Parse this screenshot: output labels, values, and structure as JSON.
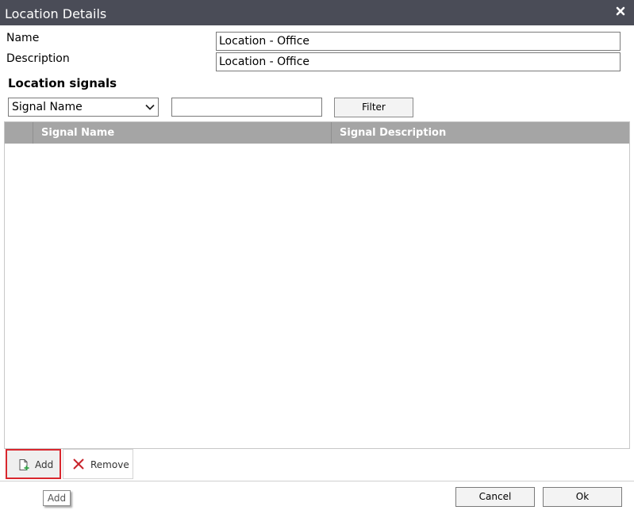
{
  "window": {
    "title": "Location Details",
    "close_icon": "close-icon"
  },
  "form": {
    "name_label": "Name",
    "name_value": "Location - Office",
    "description_label": "Description",
    "description_value": "Location - Office"
  },
  "signals": {
    "section_title": "Location signals",
    "filter_field_selected": "Signal Name",
    "filter_text_value": "",
    "filter_button_label": "Filter",
    "columns": [
      "Signal Name",
      "Signal Description"
    ],
    "rows": []
  },
  "toolbar": {
    "add_label": "Add",
    "add_icon": "new-document-icon",
    "remove_label": "Remove",
    "remove_icon": "red-x-icon",
    "tooltip": "Add",
    "add_highlight_color": "#d9272e"
  },
  "footer": {
    "cancel_label": "Cancel",
    "ok_label": "Ok"
  },
  "colors": {
    "titlebar": "#4a4c57",
    "grid_header": "#a5a5a5"
  }
}
